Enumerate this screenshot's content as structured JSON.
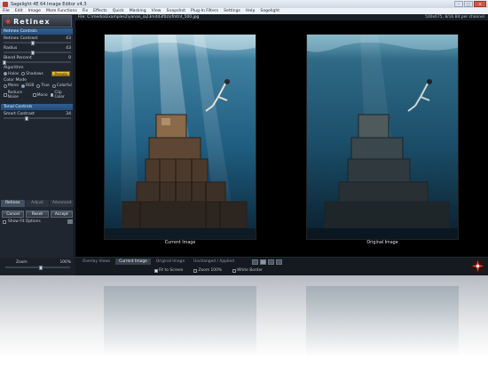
{
  "window": {
    "title": "Sagelight 4E 64 Image Editor v4.3",
    "controls": [
      "–",
      "□",
      "✕"
    ]
  },
  "menu": [
    "File",
    "Edit",
    "Image",
    "More Functions",
    "Fix",
    "Effects",
    "Quick",
    "Masking",
    "View",
    "Snapshot",
    "Plug-In Filters",
    "Settings",
    "Help",
    "Sagelight"
  ],
  "left_panel": {
    "logo_text": "Retinex",
    "section_retinex": "Retinex Controls",
    "sliders": [
      {
        "label": "Retinex Contrast",
        "value": "43",
        "fraction": 0.43
      },
      {
        "label": "Radius",
        "value": "43",
        "fraction": 0.43
      },
      {
        "label": "Blend Percent",
        "value": "0",
        "fraction": 0.0
      }
    ],
    "algorithm_label": "Algorithm",
    "algorithm_options": [
      {
        "label": "Halos",
        "selected": true
      },
      {
        "label": "Shadows",
        "selected": false
      }
    ],
    "presets_label": "Presets",
    "color_mode_label": "Color Mode",
    "color_mode_options": [
      {
        "label": "Mono",
        "selected": false
      },
      {
        "label": "RGB",
        "selected": true
      },
      {
        "label": "True",
        "selected": false
      },
      {
        "label": "Colorful",
        "selected": false
      }
    ],
    "checks": [
      {
        "label": "Reduce Noise",
        "checked": false
      },
      {
        "label": "Mono",
        "checked": false
      },
      {
        "label": "Clip Color",
        "checked": true
      }
    ],
    "section_tone": "Tonal Controls",
    "tone_slider": {
      "label": "Smart Contrast",
      "value": "34",
      "fraction": 0.34
    },
    "tabs": [
      "Retinex",
      "Adjust",
      "Advanced"
    ],
    "active_tab": "Retinex",
    "buttons": {
      "cancel": "Cancel",
      "reset": "Reset",
      "accept": "Accept"
    },
    "show_fit": "Show Fit Options"
  },
  "file_bar": {
    "path": "File: C:\\media\\Examples2\\yanan_ia23mitd3f0z\\sfmtnt_500.jpg",
    "info": "500x675, 8/16 Bit per channel"
  },
  "canvas": {
    "current_caption": "Current Image",
    "original_caption": "Original Image"
  },
  "view_bar": {
    "tabs": [
      "Overlay Views",
      "Current Image",
      "Original Image",
      "Unchanged / Applied"
    ],
    "active_tab": "Current Image"
  },
  "zoom": {
    "label": "Zoom",
    "value": "100%",
    "fraction": 0.55
  },
  "options_bar": {
    "fit_to_screen": "Fit to Screen",
    "zoom_100": "Zoom 100%",
    "white_border": "White Border"
  },
  "colors": {
    "accent_blue": "#2f5f92",
    "presets_yellow": "#d9b232",
    "brand_red": "#c23a2b"
  }
}
